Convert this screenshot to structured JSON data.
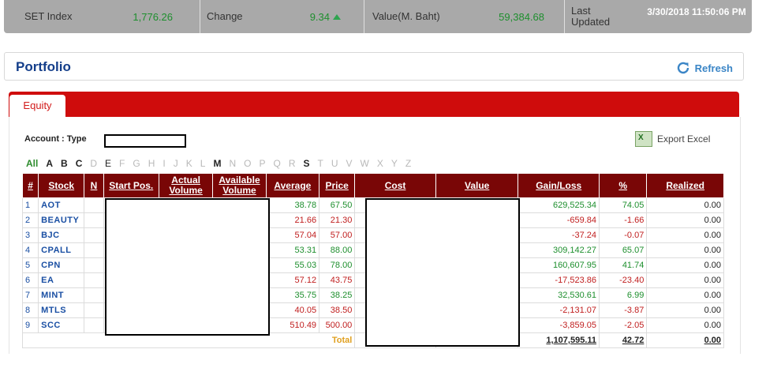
{
  "ticker": {
    "set_label": "SET Index",
    "set_value": "1,776.26",
    "change_label": "Change",
    "change_value": "9.34",
    "value_label": "Value(M. Baht)",
    "value_value": "59,384.68",
    "updated_label": "Last Updated",
    "updated_value": "3/30/2018 11:50:06 PM"
  },
  "header": {
    "title": "Portfolio",
    "refresh_label": "Refresh"
  },
  "tabs": [
    {
      "label": "Equity"
    }
  ],
  "account": {
    "label": "Account : Type"
  },
  "export_label": "Export Excel",
  "alphabet": [
    {
      "l": "All",
      "s": "all"
    },
    {
      "l": "A",
      "s": "on"
    },
    {
      "l": "B",
      "s": "on"
    },
    {
      "l": "C",
      "s": "on"
    },
    {
      "l": "D",
      "s": "off"
    },
    {
      "l": "E",
      "s": "onplain"
    },
    {
      "l": "F",
      "s": "off"
    },
    {
      "l": "G",
      "s": "off"
    },
    {
      "l": "H",
      "s": "off"
    },
    {
      "l": "I",
      "s": "off"
    },
    {
      "l": "J",
      "s": "off"
    },
    {
      "l": "K",
      "s": "off"
    },
    {
      "l": "L",
      "s": "off"
    },
    {
      "l": "M",
      "s": "on"
    },
    {
      "l": "N",
      "s": "off"
    },
    {
      "l": "O",
      "s": "off"
    },
    {
      "l": "P",
      "s": "off"
    },
    {
      "l": "Q",
      "s": "off"
    },
    {
      "l": "R",
      "s": "off"
    },
    {
      "l": "S",
      "s": "on"
    },
    {
      "l": "T",
      "s": "off"
    },
    {
      "l": "U",
      "s": "off"
    },
    {
      "l": "V",
      "s": "off"
    },
    {
      "l": "W",
      "s": "off"
    },
    {
      "l": "X",
      "s": "off"
    },
    {
      "l": "Y",
      "s": "off"
    },
    {
      "l": "Z",
      "s": "off"
    }
  ],
  "table": {
    "headers": [
      "#",
      "Stock",
      "N",
      "Start Pos.",
      "Actual Volume",
      "Available Volume",
      "Average",
      "Price",
      "Cost",
      "Value",
      "Gain/Loss",
      "%",
      "Realized"
    ],
    "rows": [
      {
        "n": "1",
        "stock": "AOT",
        "avg": "38.78",
        "price": "67.50",
        "gl": "629,525.34",
        "pct": "74.05",
        "realized": "0.00",
        "dir": "up"
      },
      {
        "n": "2",
        "stock": "BEAUTY",
        "avg": "21.66",
        "price": "21.30",
        "gl": "-659.84",
        "pct": "-1.66",
        "realized": "0.00",
        "dir": "down"
      },
      {
        "n": "3",
        "stock": "BJC",
        "avg": "57.04",
        "price": "57.00",
        "gl": "-37.24",
        "pct": "-0.07",
        "realized": "0.00",
        "dir": "down"
      },
      {
        "n": "4",
        "stock": "CPALL",
        "avg": "53.31",
        "price": "88.00",
        "gl": "309,142.27",
        "pct": "65.07",
        "realized": "0.00",
        "dir": "up"
      },
      {
        "n": "5",
        "stock": "CPN",
        "avg": "55.03",
        "price": "78.00",
        "gl": "160,607.95",
        "pct": "41.74",
        "realized": "0.00",
        "dir": "up"
      },
      {
        "n": "6",
        "stock": "EA",
        "avg": "57.12",
        "price": "43.75",
        "gl": "-17,523.86",
        "pct": "-23.40",
        "realized": "0.00",
        "dir": "down"
      },
      {
        "n": "7",
        "stock": "MINT",
        "avg": "35.75",
        "price": "38.25",
        "gl": "32,530.61",
        "pct": "6.99",
        "realized": "0.00",
        "dir": "up"
      },
      {
        "n": "8",
        "stock": "MTLS",
        "avg": "40.05",
        "price": "38.50",
        "gl": "-2,131.07",
        "pct": "-3.87",
        "realized": "0.00",
        "dir": "down"
      },
      {
        "n": "9",
        "stock": "SCC",
        "avg": "510.49",
        "price": "500.00",
        "gl": "-3,859.05",
        "pct": "-2.05",
        "realized": "0.00",
        "dir": "down"
      }
    ],
    "total": {
      "label": "Total",
      "gl": "1,107,595.11",
      "pct": "42.72",
      "realized": "0.00"
    }
  }
}
